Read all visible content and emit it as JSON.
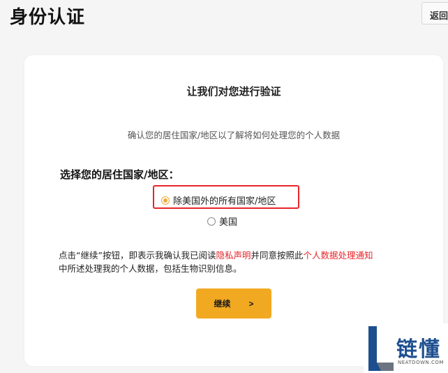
{
  "header": {
    "title": "身份认证",
    "back_label": "返回"
  },
  "card": {
    "heading": "让我们对您进行验证",
    "subtitle": "确认您的居住国家/地区以了解将如何处理您的个人数据",
    "residence_label": "选择您的居住国家/地区：",
    "options": [
      {
        "label": "除美国外的所有国家/地区",
        "selected": true
      },
      {
        "label": "美国",
        "selected": false
      }
    ],
    "consent": {
      "part1": "点击“继续”按钮，即表示我确认我已阅读",
      "privacy_link": "隐私声明",
      "part2": "并同意按照此",
      "notice_link": "个人数据处理通知",
      "part3": "中所述处理我的个人数据，包括生物识别信息。"
    },
    "continue_label": "继续",
    "continue_chevron": ">"
  },
  "colors": {
    "accent": "#f2a922",
    "link": "#e8252a",
    "highlight": "#e8252a"
  },
  "watermark": {
    "text": "链懂",
    "sub": "NEATDOWN.COM"
  }
}
